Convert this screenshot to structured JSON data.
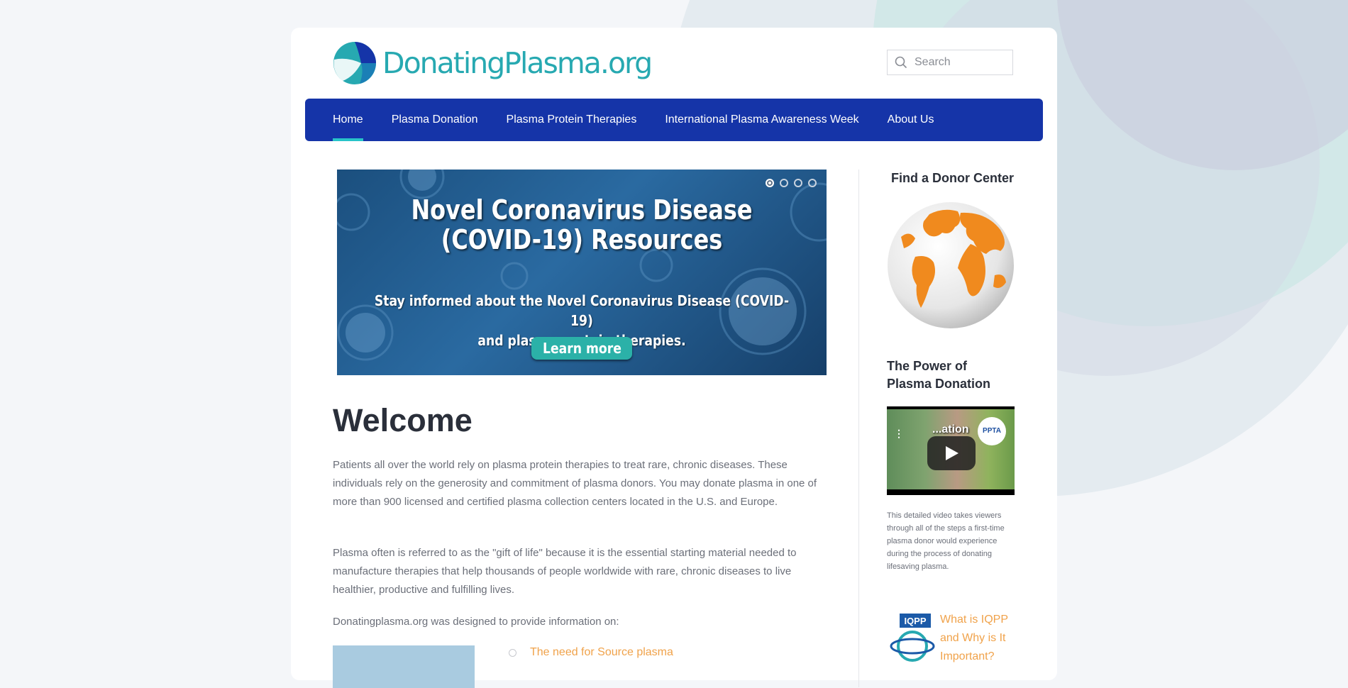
{
  "site": {
    "logo_text": "DonatingPlasma",
    "logo_suffix": ".org"
  },
  "search": {
    "placeholder": "Search"
  },
  "nav": {
    "items": [
      {
        "label": "Home",
        "active": true
      },
      {
        "label": "Plasma Donation",
        "active": false
      },
      {
        "label": "Plasma Protein Therapies",
        "active": false
      },
      {
        "label": "International Plasma Awareness Week",
        "active": false
      },
      {
        "label": "About Us",
        "active": false
      }
    ]
  },
  "hero": {
    "title": "Novel Coronavirus Disease (COVID-19) Resources",
    "subtitle_line1": "Stay informed about the Novel Coronavirus Disease (COVID-19)",
    "subtitle_line2": "and plasma protein therapies.",
    "button_label": "Learn more",
    "slide_count": 4,
    "active_slide": 1
  },
  "main": {
    "heading": "Welcome",
    "paragraphs": [
      "Patients all over the world rely on plasma protein therapies to treat rare, chronic diseases. These individuals rely on the generosity and commitment of plasma donors. You may donate plasma in one of more than 900 licensed and certified plasma collection centers located in the U.S. and Europe.",
      "Plasma often is referred to as the \"gift of life\" because it is the essential starting material needed to manufacture therapies that help thousands of people worldwide with rare, chronic diseases to live healthier, productive and fulfilling lives.",
      "Donatingplasma.org was designed to provide information on:"
    ],
    "info_list": [
      "The need for Source plasma"
    ]
  },
  "sidebar": {
    "donor_center_title": "Find a Donor Center",
    "video_section_title": "The Power of Plasma Donation",
    "video_overlay_text": "...ation",
    "video_logo_text": "PPTA",
    "video_description": "This detailed video takes viewers through all of the steps a first-time plasma donor would experience during the process of donating lifesaving plasma.",
    "iqpp_logo_text": "IQPP",
    "iqpp_link": "What is IQPP and Why is It Important?"
  },
  "colors": {
    "nav_bg": "#1534a8",
    "accent_teal": "#27a9b1",
    "link_orange": "#f0a24a",
    "text_dark": "#2a2f3a",
    "text_body": "#6b6f79"
  }
}
